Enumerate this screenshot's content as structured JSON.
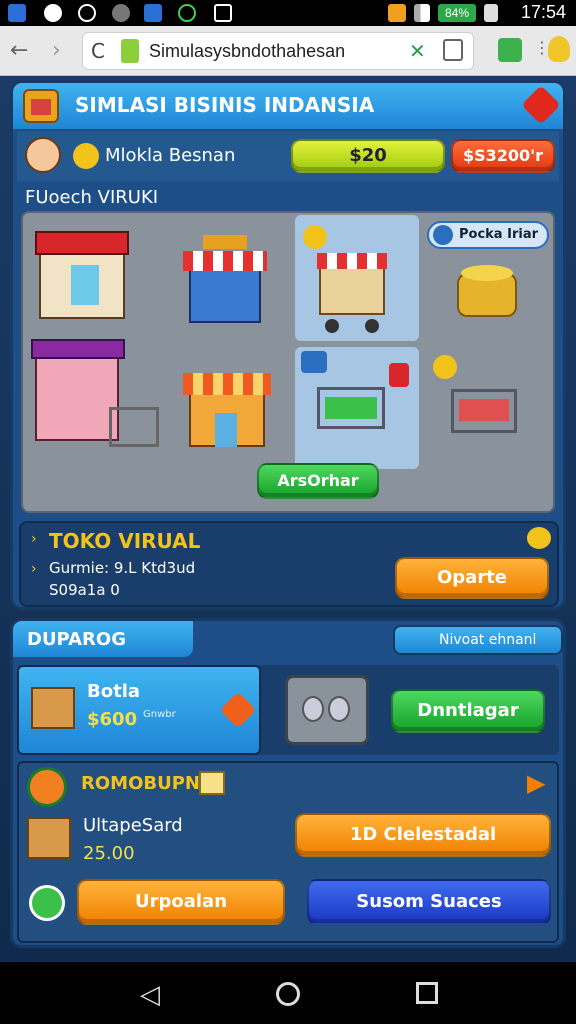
{
  "status_bar": {
    "time": "17:54",
    "battery_label": "84%"
  },
  "browser": {
    "url": "Simulasysbndothahesan"
  },
  "header": {
    "title": "SIMLASI BISINIS INDANSIA"
  },
  "player": {
    "name": "Mlokla Besnan",
    "coins": "$20",
    "money": "$S3200'r"
  },
  "store_section": {
    "label": "FUoech VIRUKI",
    "tag": "Pocka Iriar",
    "action_button": "ArsOrhar"
  },
  "toko": {
    "title": "TOKO VIRUAL",
    "line1": "Gurmie: 9.L Ktd3ud",
    "line2": "S09a1a 0",
    "button": "Oparte"
  },
  "market": {
    "tab_left": "DUPAROG",
    "tab_right": "Nivoat ehnanl",
    "item": {
      "name": "Botla",
      "price": "$600",
      "sub": "Gnwbr"
    },
    "buy_button": "Dnntlagar"
  },
  "promo": {
    "title": "ROMOBUPN",
    "item_name": "UltapeSard",
    "item_price": "25.00",
    "action_button": "1D Clelestadal",
    "left_button": "Urpoalan",
    "right_button": "Susom Suaces"
  },
  "colors": {
    "accent_orange": "#f08000",
    "accent_green": "#15a02a",
    "accent_blue": "#1a37c0",
    "panel_blue": "#2a5d96"
  }
}
